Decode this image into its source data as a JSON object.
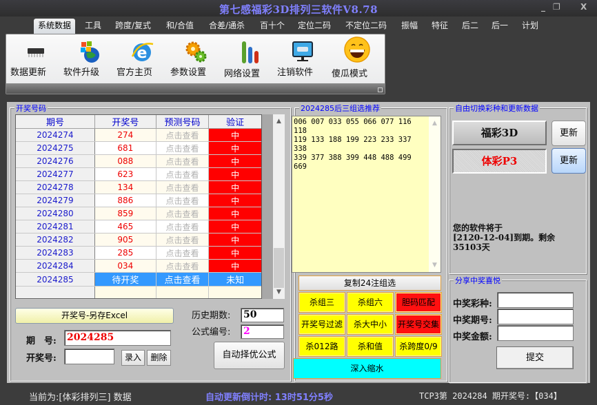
{
  "window": {
    "title": "第七感福彩3D排列三软件V8.78",
    "minimize": "_",
    "restore": "❐",
    "close": "X"
  },
  "menu": {
    "items": [
      "系统数据",
      "工具",
      "跨度/复式",
      "和/合值",
      "合差/通杀",
      "百十个",
      "定位二码",
      "不定位二码",
      "振幅",
      "特征",
      "后二",
      "后一",
      "计划"
    ],
    "active_index": 0
  },
  "ribbon": {
    "buttons": [
      {
        "label": "数据更新",
        "icon": "chip-icon"
      },
      {
        "label": "软件升级",
        "icon": "windows-globe-icon"
      },
      {
        "label": "官方主页",
        "icon": "ie-browser-icon"
      },
      {
        "label": "参数设置",
        "icon": "gears-icon"
      },
      {
        "label": "网络设置",
        "icon": "bar-chart-icon"
      },
      {
        "label": "注销软件",
        "icon": "monitor-icon"
      },
      {
        "label": "傻瓜模式",
        "icon": "smiley-icon"
      }
    ]
  },
  "draw_panel": {
    "title": "开奖号码",
    "columns": [
      "期号",
      "开奖号",
      "预测号码",
      "验证"
    ],
    "rows": [
      {
        "period": "2024274",
        "number": "274",
        "prediction": "点击查看",
        "result": "中"
      },
      {
        "period": "2024275",
        "number": "681",
        "prediction": "点击查看",
        "result": "中"
      },
      {
        "period": "2024276",
        "number": "088",
        "prediction": "点击查看",
        "result": "中"
      },
      {
        "period": "2024277",
        "number": "623",
        "prediction": "点击查看",
        "result": "中"
      },
      {
        "period": "2024278",
        "number": "134",
        "prediction": "点击查看",
        "result": "中"
      },
      {
        "period": "2024279",
        "number": "886",
        "prediction": "点击查看",
        "result": "中"
      },
      {
        "period": "2024280",
        "number": "859",
        "prediction": "点击查看",
        "result": "中"
      },
      {
        "period": "2024281",
        "number": "465",
        "prediction": "点击查看",
        "result": "中"
      },
      {
        "period": "2024282",
        "number": "905",
        "prediction": "点击查看",
        "result": "中"
      },
      {
        "period": "2024283",
        "number": "285",
        "prediction": "点击查看",
        "result": "中"
      },
      {
        "period": "2024284",
        "number": "034",
        "prediction": "点击查看",
        "result": "中"
      },
      {
        "period": "2024285",
        "number": "待开奖",
        "prediction": "点击查看",
        "result": "未知"
      }
    ],
    "export_button": "开奖号-另存Excel",
    "period_label": "期　号:",
    "period_value": "2024285",
    "number_label": "开奖号:",
    "number_value": "",
    "enter_button": "录入",
    "delete_button": "删除",
    "history_label": "历史期数:",
    "history_value": "50",
    "formula_label": "公式编号:",
    "formula_value": "2",
    "auto_button": "自动择优公式"
  },
  "recommend_panel": {
    "title": "2024285后三组选推荐",
    "numbers": [
      "006",
      "007",
      "033",
      "055",
      "066",
      "077",
      "116",
      "118",
      "119",
      "133",
      "188",
      "199",
      "223",
      "233",
      "337",
      "338",
      "339",
      "377",
      "388",
      "399",
      "448",
      "488",
      "499",
      "669"
    ],
    "copy_button": "复制24注组选",
    "filter_buttons": [
      {
        "label": "杀组三",
        "color": "yellow"
      },
      {
        "label": "杀组六",
        "color": "yellow"
      },
      {
        "label": "胆码匹配",
        "color": "red"
      },
      {
        "label": "开奖号过滤",
        "color": "yellow"
      },
      {
        "label": "杀大中小",
        "color": "yellow"
      },
      {
        "label": "开奖号交集",
        "color": "red"
      },
      {
        "label": "杀012路",
        "color": "yellow"
      },
      {
        "label": "杀和值",
        "color": "yellow"
      },
      {
        "label": "杀跨度0/9",
        "color": "yellow"
      }
    ],
    "deep_button": "深入缩水"
  },
  "switch_panel": {
    "title": "自由切换彩种和更新数据",
    "lottery1": "福彩3D",
    "lottery2": "体彩P3",
    "update1": "更新",
    "update2": "更新",
    "expiry_text": "您的软件将于\n[2120-12-04]到期。剩余\n35103天"
  },
  "share_panel": {
    "title": "分享中奖喜悦",
    "fields": [
      {
        "label": "中奖彩种:",
        "value": ""
      },
      {
        "label": "中奖期号:",
        "value": ""
      },
      {
        "label": "中奖金额:",
        "value": ""
      }
    ],
    "submit": "提交"
  },
  "status": {
    "current": "当前为:[体彩排列三] 数据",
    "countdown": "自动更新倒计时: 13时51分5秒",
    "last_draw": "TCP3第 2024284 期开奖号:【034】"
  },
  "colors": {
    "accent_blue": "#3399ff",
    "hit_red": "#ff0000",
    "title_purple": "#8080ff",
    "recommend_bg": "#ffffc0",
    "filter_yellow": "#ffff00",
    "deep_cyan": "#00ffff"
  }
}
